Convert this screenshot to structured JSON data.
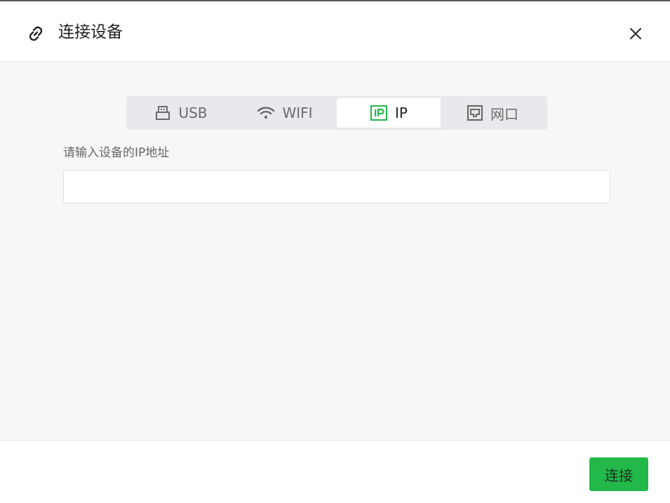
{
  "dialog": {
    "title": "连接设备",
    "title_icon": "link-icon",
    "close_icon": "close-icon"
  },
  "tabs": [
    {
      "label": "USB",
      "icon": "usb-icon",
      "active": false
    },
    {
      "label": "WIFI",
      "icon": "wifi-icon",
      "active": false
    },
    {
      "label": "IP",
      "icon": "ip-icon",
      "active": true
    },
    {
      "label": "网口",
      "icon": "ethernet-port-icon",
      "active": false
    }
  ],
  "form": {
    "label": "请输入设备的IP地址",
    "ip_value": "",
    "ip_placeholder": ""
  },
  "footer": {
    "connect_label": "连接"
  },
  "colors": {
    "accent": "#22b84a",
    "body_bg": "#f6f7f9",
    "tab_bar_bg": "#e8e9ec"
  }
}
